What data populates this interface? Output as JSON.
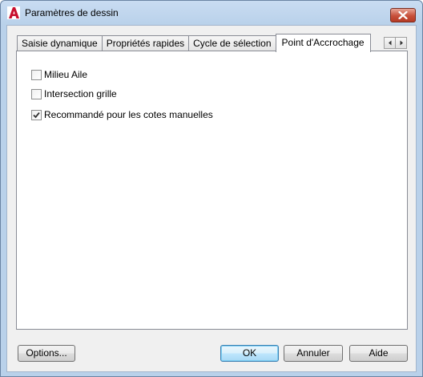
{
  "window": {
    "title": "Paramètres de dessin"
  },
  "tabs": [
    {
      "label": "Saisie dynamique",
      "active": false
    },
    {
      "label": "Propriétés rapides",
      "active": false
    },
    {
      "label": "Cycle de sélection",
      "active": false
    },
    {
      "label": "Point d'Accrochage",
      "active": true
    }
  ],
  "options": [
    {
      "label": "Milieu Aile",
      "checked": false
    },
    {
      "label": "Intersection grille",
      "checked": false
    },
    {
      "label": "Recommandé pour les cotes manuelles",
      "checked": true
    }
  ],
  "buttons": {
    "options_label": "Options...",
    "ok_label": "OK",
    "cancel_label": "Annuler",
    "help_label": "Aide"
  },
  "colors": {
    "title_bar": "#b9d1ea",
    "close_button": "#c7503a",
    "app_icon": "#c8102e"
  },
  "icons": [
    "app-logo-icon",
    "close-icon",
    "scroll-left-icon",
    "scroll-right-icon",
    "checkmark-icon"
  ]
}
